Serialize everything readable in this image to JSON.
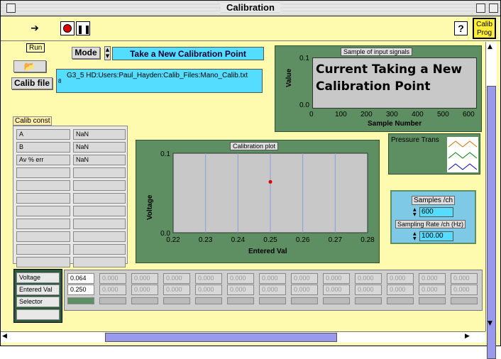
{
  "window": {
    "title": "Calibration"
  },
  "toolbar": {
    "run_tooltip": "Run",
    "help_label": "?",
    "calib_prog_label": "Calib Prog"
  },
  "mode": {
    "label": "Mode",
    "value": "Take a New Calibration Point"
  },
  "calib_file": {
    "label": "Calib file",
    "path": "G3_5 HD:Users:Paul_Hayden:Calib_Files:Mano_Calib.txt",
    "path_prefix": "8"
  },
  "input_signals": {
    "title": "Sample of input signals",
    "overlay_text": "Current Taking a New Calibration Point",
    "ylabel": "Value",
    "xlabel": "Sample Number",
    "yticks": [
      "0.1",
      "0.0"
    ],
    "xticks": [
      "0",
      "100",
      "200",
      "300",
      "400",
      "500",
      "600"
    ]
  },
  "pressure_trans": {
    "label": "Pressure Trans"
  },
  "calib_const": {
    "title": "Calib const",
    "rows": [
      {
        "name": "A",
        "value": "NaN"
      },
      {
        "name": "B",
        "value": "NaN"
      },
      {
        "name": "Av % err",
        "value": "NaN"
      }
    ]
  },
  "calibration_plot": {
    "title": "Calibration plot",
    "ylabel": "Voltage",
    "xlabel": "Entered Val",
    "yticks": [
      "0.1",
      "0.0"
    ],
    "xticks": [
      "0.22",
      "0.23",
      "0.24",
      "0.25",
      "0.26",
      "0.27",
      "0.28"
    ]
  },
  "chart_data": {
    "type": "scatter",
    "title": "Calibration plot",
    "xlabel": "Entered Val",
    "ylabel": "Voltage",
    "xlim": [
      0.22,
      0.28
    ],
    "ylim": [
      0.0,
      0.1
    ],
    "points": [
      {
        "x": 0.25,
        "y": 0.064
      }
    ],
    "grid": "vertical"
  },
  "sampling": {
    "samples_label": "Samples /ch",
    "samples_value": "600",
    "rate_label": "Sampling Rate /ch (Hz)",
    "rate_value": "100.00"
  },
  "bottom_table": {
    "row_labels": [
      "Voltage",
      "Entered Val",
      "Selector"
    ],
    "first_col": [
      "0.064",
      "0.250"
    ],
    "empty_placeholder": "0.000"
  },
  "colors": {
    "background": "#fffbae",
    "panel": "#5e8f62",
    "accent": "#55ddff",
    "point": "#dd0000"
  }
}
